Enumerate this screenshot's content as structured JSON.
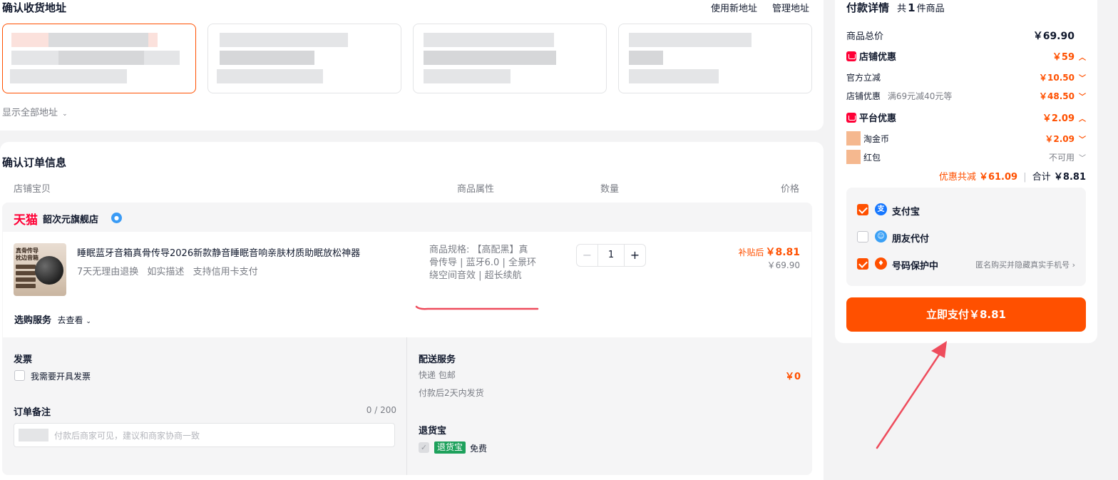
{
  "address": {
    "title": "确认收货地址",
    "new_link": "使用新地址",
    "manage_link": "管理地址",
    "show_all": "显示全部地址"
  },
  "order": {
    "title": "确认订单信息",
    "columns": [
      "店铺宝贝",
      "商品属性",
      "数量",
      "价格"
    ],
    "shop_brand": "天猫",
    "shop_name": "韶次元旗舰店",
    "item": {
      "thumb_text": "真骨传导 枕边音箱",
      "title": "睡眠蓝牙音箱真骨传导2026新款静音睡眠音响亲肤材质助眠放松神器",
      "promises": [
        "7天无理由退换",
        "如实描述",
        "支持信用卡支付"
      ],
      "sku": "商品规格: 【高配黑】真骨传导 | 蓝牙6.0 | 全景环绕空间音效 | 超长续航",
      "quantity": "1",
      "price_label": "补贴后",
      "price_after": "￥8.81",
      "price_orig": "￥69.90"
    },
    "service_label": "选购服务",
    "service_more": "去查看",
    "invoice": {
      "title": "发票",
      "option": "我需要开具发票"
    },
    "note": {
      "title": "订单备注",
      "count": "0 / 200",
      "placeholder": "付款后商家可见，建议和商家协商一致"
    },
    "delivery": {
      "title": "配送服务",
      "method": "快递 包邮",
      "eta": "付款后2天内发货",
      "price": "￥0"
    },
    "return_ins": {
      "title": "退货宝",
      "tag": "退货宝",
      "fee": "免费"
    }
  },
  "payment": {
    "title": "付款详情",
    "count_prefix": "共",
    "count": "1",
    "count_suffix": "件商品",
    "goods_total_label": "商品总价",
    "goods_total": "￥69.90",
    "shop_discount_label": "店铺优惠",
    "shop_discount": "￥59",
    "official_label": "官方立减",
    "official": "￥10.50",
    "shop_coupon_label": "店铺优惠",
    "shop_coupon_note": "满69元减40元等",
    "shop_coupon": "￥48.50",
    "platform_label": "平台优惠",
    "platform": "￥2.09",
    "coin_label": "淘金币",
    "coin": "￥2.09",
    "redpack_label": "红包",
    "redpack": "不可用",
    "saved_label": "优惠共减",
    "saved": "￥61.09",
    "total_label": "合计",
    "total": "￥8.81",
    "methods": [
      {
        "label": "支付宝",
        "checked": true
      },
      {
        "label": "朋友代付",
        "checked": false
      },
      {
        "label": "号码保护中",
        "checked": true,
        "tip": "匿名购买并隐藏真实手机号"
      }
    ],
    "pay_button": "立即支付￥8.81"
  },
  "colors": {
    "accent": "#ff5000",
    "tmall": "#ff0036",
    "alipay": "#1677ff",
    "green": "#1ea15c"
  }
}
